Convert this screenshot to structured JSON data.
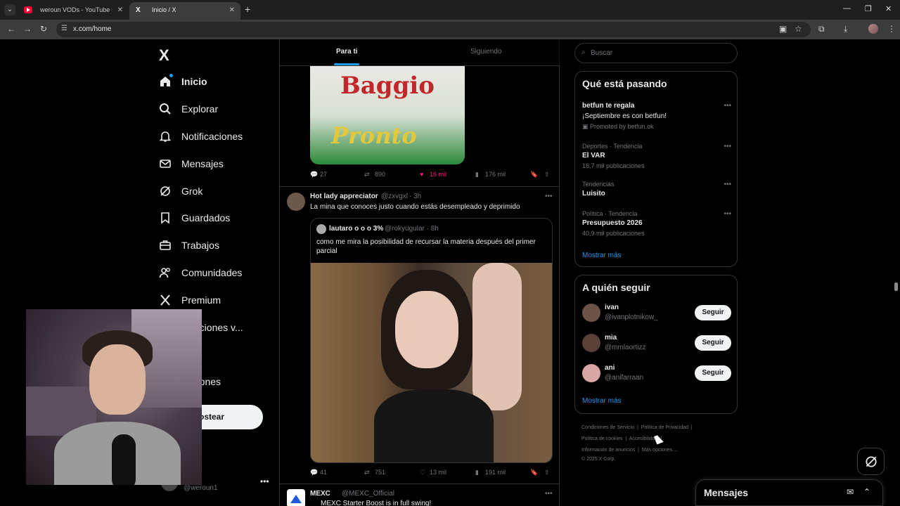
{
  "browser": {
    "tabs": [
      {
        "title": "weroun VODs - YouTube"
      },
      {
        "title": "Inicio / X"
      }
    ],
    "url": "x.com/home"
  },
  "nav": {
    "items": [
      {
        "label": "Inicio",
        "icon": "home-icon"
      },
      {
        "label": "Explorar",
        "icon": "search-icon"
      },
      {
        "label": "Notificaciones",
        "icon": "bell-icon"
      },
      {
        "label": "Mensajes",
        "icon": "mail-icon"
      },
      {
        "label": "Grok",
        "icon": "grok-icon"
      },
      {
        "label": "Guardados",
        "icon": "bookmark-icon"
      },
      {
        "label": "Trabajos",
        "icon": "briefcase-icon"
      },
      {
        "label": "Comunidades",
        "icon": "people-icon"
      },
      {
        "label": "Premium",
        "icon": "x-icon"
      },
      {
        "label": "nizaciones v...",
        "icon": "org-icon"
      },
      {
        "label": "l",
        "icon": "profile-icon"
      },
      {
        "label": "opciones",
        "icon": "more-icon"
      }
    ],
    "post_label": "ostear",
    "account_name": "un",
    "account_handle": "@weroun1"
  },
  "feed": {
    "tabs": [
      "Para ti",
      "Siguiendo"
    ],
    "post1": {
      "image_text_top": "Baggio",
      "image_text_bottom": "Pronto",
      "replies": "27",
      "reposts": "890",
      "likes": "16 mil",
      "views": "176 mil"
    },
    "post2": {
      "name": "Hot lady appreciator",
      "handle": "@zxvgxl",
      "time": "· 3h",
      "text": "La mina que conoces justo cuando estás desempleado y deprimido",
      "quote": {
        "name": "lautaro o o o 3%",
        "handle": "@rokyugular",
        "time": "· 8h",
        "text": "como me mira la posibilidad de recursar la materia después del primer parcial"
      },
      "replies": "41",
      "reposts": "751",
      "likes": "13 mil",
      "views": "191 mil"
    },
    "post3": {
      "name": "MEXC",
      "handle": "@MEXC_Official",
      "text": "MEXC Starter Boost is in full swing!"
    }
  },
  "sidebar": {
    "search_placeholder": "Buscar",
    "trends_title": "Qué está pasando",
    "trends": [
      {
        "title": "betfun te regala",
        "desc": "¡Septiembre es con betfun!",
        "promoted": "Promoted by betfun.ok"
      },
      {
        "meta": "Deportes · Tendencia",
        "title": "El VAR",
        "sub": "16,7 mil publicaciones"
      },
      {
        "meta": "Tendencias",
        "title": "Luisito",
        "sub": ""
      },
      {
        "meta": "Política · Tendencia",
        "title": "Presupuesto 2026",
        "sub": "40,9 mil publicaciones"
      }
    ],
    "show_more": "Mostrar más",
    "follow_title": "A quién seguir",
    "follow": [
      {
        "name": "ivan",
        "handle": "@ivanplotnikow_",
        "btn": "Seguir"
      },
      {
        "name": "mia",
        "handle": "@mmlaortizz",
        "btn": "Seguir"
      },
      {
        "name": "ani",
        "handle": "@anifarraan",
        "btn": "Seguir"
      }
    ],
    "footer": {
      "terms": "Condiciones de Servicio",
      "privacy": "Política de Privacidad",
      "cookies": "Política de cookies",
      "accessibility": "Accesibilidad",
      "ads": "Información de anuncios",
      "more": "Más opciones ...",
      "copyright": "© 2025 X Corp."
    }
  },
  "messages_drawer": {
    "title": "Mensajes"
  }
}
